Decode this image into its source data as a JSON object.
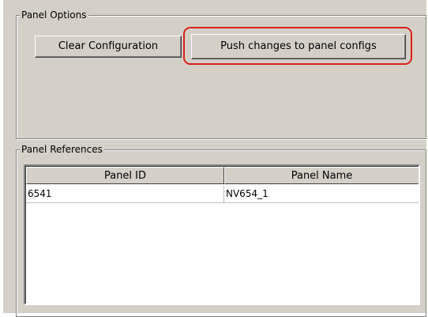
{
  "panel_options": {
    "title": "Panel Options",
    "clear_button_label": "Clear Configuration",
    "push_button_label": "Push changes to panel configs"
  },
  "panel_references": {
    "title": "Panel References",
    "columns": [
      "Panel ID",
      "Panel Name"
    ],
    "rows": [
      {
        "panel_id": "6541",
        "panel_name": "NV654_1"
      }
    ]
  },
  "colors": {
    "window_background": "#d4d0c8",
    "highlight": "#d9201a"
  }
}
